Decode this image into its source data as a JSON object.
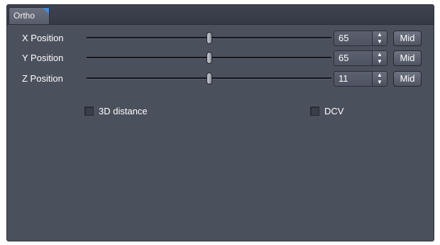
{
  "tab": {
    "label": "Ortho"
  },
  "rows": [
    {
      "label": "X Position",
      "value": "65",
      "slider_fraction": 0.5,
      "mid_label": "Mid"
    },
    {
      "label": "Y Position",
      "value": "65",
      "slider_fraction": 0.5,
      "mid_label": "Mid"
    },
    {
      "label": "Z Position",
      "value": "11",
      "slider_fraction": 0.5,
      "mid_label": "Mid"
    }
  ],
  "options": {
    "distance_3d": {
      "label": "3D distance",
      "checked": false
    },
    "dcv": {
      "label": "DCV",
      "checked": false
    }
  },
  "colors": {
    "panel_bg": "#4b505d",
    "tab_accent": "#3b8de0",
    "text": "#ffffff"
  }
}
